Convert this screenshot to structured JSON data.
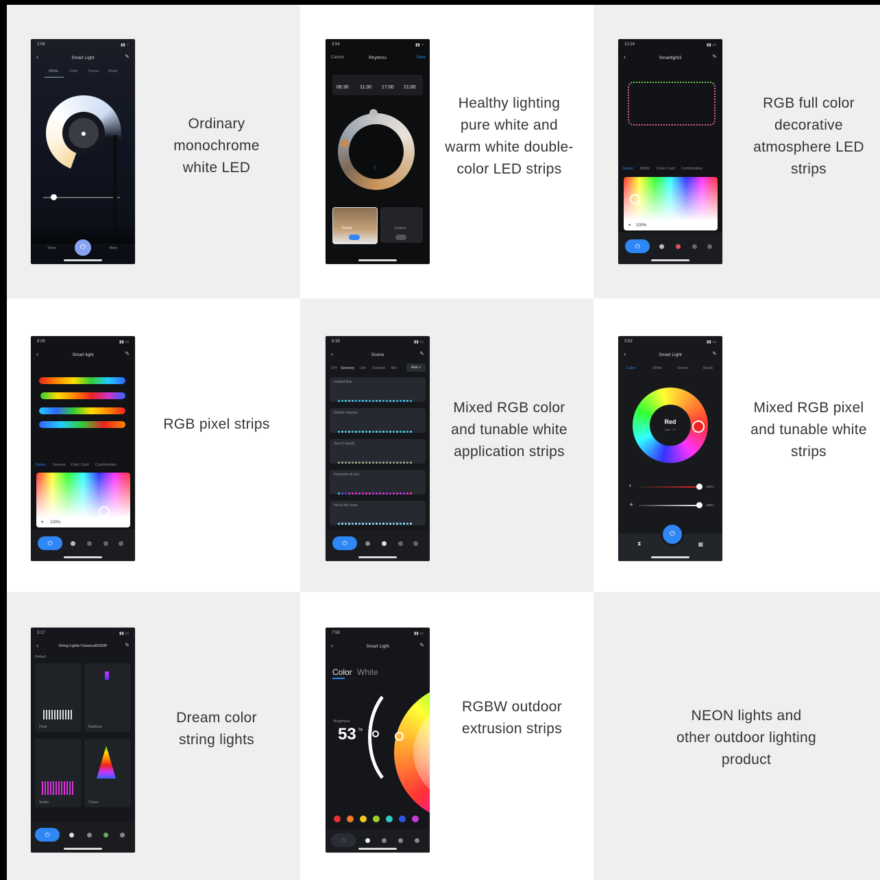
{
  "captions": {
    "c1": "Ordinary monochrome white LED",
    "c2": "Healthy lighting pure white and warm white double-color LED strips",
    "c3": "RGB full color decorative atmosphere LED strips",
    "c4": "RGB pixel strips",
    "c5": "Mixed RGB color and tunable white application strips",
    "c6": "Mixed RGB pixel and tunable white strips",
    "c7": "Dream color string lights",
    "c8": "RGBW outdoor extrusion strips",
    "c9": "NEON lights and other outdoor lighting product"
  },
  "phone1": {
    "time": "2:06",
    "title": "Smart Light",
    "tabs": [
      "White",
      "Color",
      "Scene",
      "Music"
    ],
    "timer": "Timer",
    "more": "More"
  },
  "phone2": {
    "time": "3:54",
    "cancel": "Cancel",
    "title": "Rhythms",
    "save": "Save",
    "times": [
      "06:30",
      "11:30",
      "17:00",
      "21:00"
    ],
    "mode1": "Preset",
    "mode2": "Custom"
  },
  "phone3": {
    "time": "10:24",
    "title": "Smartlight3",
    "tabs": [
      "Colour",
      "White",
      "Color Card",
      "Combination"
    ],
    "brightness": "100%"
  },
  "phone4": {
    "time": "8:39",
    "title": "Smart light",
    "tabs": [
      "Colour",
      "Scenes",
      "Color Card",
      "Combination"
    ],
    "brightness": "100%"
  },
  "phone5": {
    "time": "8:39",
    "title": "Scene",
    "tabs": [
      "DIY",
      "Scenery",
      "Life",
      "Festival",
      "Mo"
    ],
    "add": "Add +",
    "scenes": [
      "Iceland blue",
      "Glacier express",
      "Sea of clouds",
      "Fireworks at sea",
      "Hut in the snow"
    ]
  },
  "phone6": {
    "time": "3:53",
    "title": "Smart Light",
    "tabs": [
      "Color",
      "White",
      "Scene",
      "Music"
    ],
    "color_name": "Red",
    "color_sub": "Hue · 0°",
    "slider1": "100%",
    "slider2": "100%"
  },
  "phone7": {
    "time": "3:17",
    "title": "String Lights-ClassicalD003P",
    "section": "Default",
    "items": [
      "Float",
      "Rainbow",
      "Snake",
      "Chase"
    ]
  },
  "phone8": {
    "time": "7:58",
    "title": "Smart Light",
    "tab_color": "Color",
    "tab_white": "White",
    "brightness_label": "Brightness",
    "brightness_value": "53",
    "brightness_unit": "%"
  },
  "colors": {
    "accent": "#2f86f5",
    "gray_cell": "#efefef",
    "white_cell": "#ffffff",
    "caption": "#333333"
  },
  "swatches": [
    "#e8302c",
    "#f07a27",
    "#f2c81d",
    "#9ad12a",
    "#31c9c0",
    "#2b55e6",
    "#c63ad9"
  ]
}
